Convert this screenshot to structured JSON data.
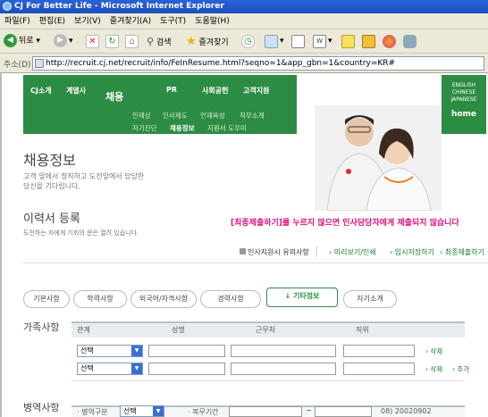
{
  "window": {
    "title": "CJ For Better Life - Microsoft Internet Explorer"
  },
  "menu": [
    "파일(F)",
    "편집(E)",
    "보기(V)",
    "즐겨찾기(A)",
    "도구(T)",
    "도움말(H)"
  ],
  "toolbar": {
    "back": "뒤로",
    "search": "검색",
    "favorites": "즐겨찾기"
  },
  "address": {
    "label": "주소(D)",
    "url": "http://recruit.cj.net/recruit/info/FeInResume.html?seqno=1&app_gbn=1&country=KR#"
  },
  "nav": {
    "items": [
      "CJ소개",
      "계열사",
      "채용",
      "PR",
      "사회공헌",
      "고객지원"
    ],
    "sub_row1": [
      "인재상",
      "인사제도",
      "인재육성",
      "직무소개"
    ],
    "sub_row2": [
      "자기진단",
      "채용정보",
      "지원서 도우미"
    ],
    "languages": [
      "ENGLISH",
      "CHINESE",
      "JAPANESE"
    ],
    "home": "home"
  },
  "page": {
    "title": "채용정보",
    "desc1": "고객 앞에서 정직하고 도전앞에서 당당한",
    "desc2": "당신을 기다립니다.",
    "resume_title": "이력서 등록",
    "resume_desc": "도전하는 자에게 기회의 문은 열려 있습니다.",
    "alert": "[최종제출하기]를 누르지 않으면 인사담당자에게 제출되지 않습니다",
    "notice_link": "인사지원시 유의사항",
    "actions": [
      "미리보기/인쇄",
      "임시저장하기",
      "최종제출하기"
    ]
  },
  "tabs": [
    "기본사항",
    "학력사항",
    "외국어/자격사항",
    "경력사항",
    "기타정보",
    "자기소개"
  ],
  "family": {
    "heading": "가족사항",
    "columns": [
      "관계",
      "성명",
      "근무처",
      "직위"
    ],
    "rows": [
      {
        "relation": "선택",
        "actions": [
          "삭제"
        ]
      },
      {
        "relation": "선택",
        "actions": [
          "삭제",
          "추가"
        ]
      }
    ]
  },
  "military": {
    "heading": "병역사항",
    "type_label": "병역구분",
    "type_value": "선택",
    "period_label": "복무기간",
    "date_value": "08) 20020902"
  }
}
